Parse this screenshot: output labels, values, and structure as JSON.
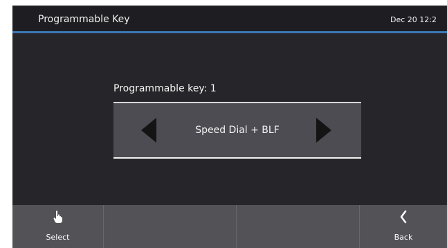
{
  "header": {
    "title": "Programmable Key",
    "datetime": "Dec 20 12:2"
  },
  "main": {
    "field_label": "Programmable key: 1",
    "selected_value": "Speed Dial + BLF"
  },
  "softkeys": [
    {
      "label": "Select",
      "icon": "hand-pointer-icon"
    },
    {
      "label": "",
      "icon": ""
    },
    {
      "label": "",
      "icon": ""
    },
    {
      "label": "Back",
      "icon": "chevron-left-icon"
    }
  ],
  "colors": {
    "background": "#26262a",
    "header_accent": "#3a78b8",
    "softkey_bar": "#525257",
    "selector": "#4d4c52"
  }
}
